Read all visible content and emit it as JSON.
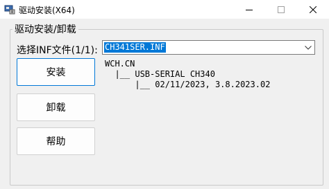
{
  "window": {
    "title": "驱动安装(X64)",
    "icon": "usb-chip-icon",
    "controls": {
      "minimize_icon": "minimize-icon",
      "maximize_icon": "maximize-icon",
      "close_icon": "close-icon"
    }
  },
  "group": {
    "title": "驱动安装/卸载"
  },
  "inf_select": {
    "label": "选择INF文件(1/1):",
    "value": "CH341SER.INF",
    "dropdown_icon": "chevron-down-icon",
    "highlight_color": "#0078d7"
  },
  "buttons": {
    "install": "安装",
    "uninstall": "卸载",
    "help": "帮助"
  },
  "driver_info": {
    "lines": [
      "WCH.CN",
      "  |__ USB-SERIAL CH340",
      "      |__ 02/11/2023, 3.8.2023.02"
    ]
  }
}
